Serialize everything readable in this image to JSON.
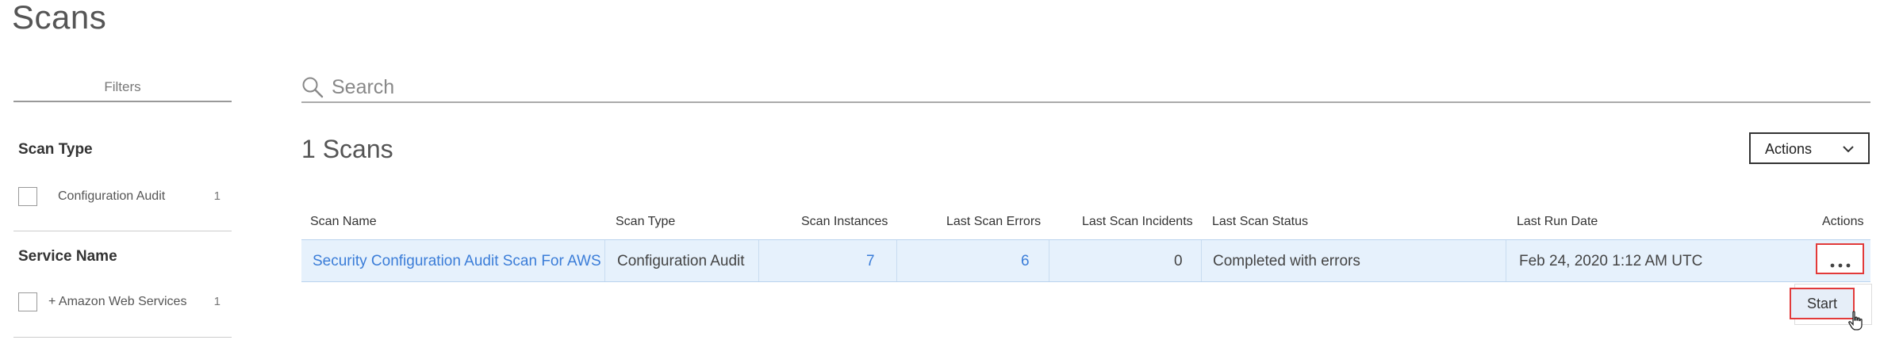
{
  "page": {
    "title": "Scans"
  },
  "sidebar": {
    "filters_label": "Filters",
    "sections": [
      {
        "title": "Scan Type",
        "items": [
          {
            "label": "Configuration Audit",
            "count": "1"
          }
        ]
      },
      {
        "title": "Service Name",
        "items": [
          {
            "label": "+ Amazon Web Services",
            "count": "1"
          }
        ]
      }
    ]
  },
  "search": {
    "placeholder": "Search",
    "icon": "search-icon"
  },
  "main": {
    "count_label": "1 Scans",
    "actions_label": "Actions",
    "table": {
      "columns": [
        "Scan Name",
        "Scan Type",
        "Scan Instances",
        "Last Scan Errors",
        "Last Scan Incidents",
        "Last Scan Status",
        "Last Run Date",
        "Actions"
      ],
      "rows": [
        {
          "scan_name": "Security Configuration Audit Scan For AWS",
          "scan_type": "Configuration Audit",
          "scan_instances": "7",
          "last_scan_errors": "6",
          "last_scan_incidents": "0",
          "last_scan_status": "Completed with errors",
          "last_run_date": "Feb 24, 2020 1:12 AM UTC"
        }
      ]
    },
    "row_menu": {
      "start_label": "Start"
    }
  },
  "colors": {
    "accent_link": "#3b7dd8",
    "row_highlight": "#e6f1fc",
    "annotation_red": "#e23a3a"
  }
}
